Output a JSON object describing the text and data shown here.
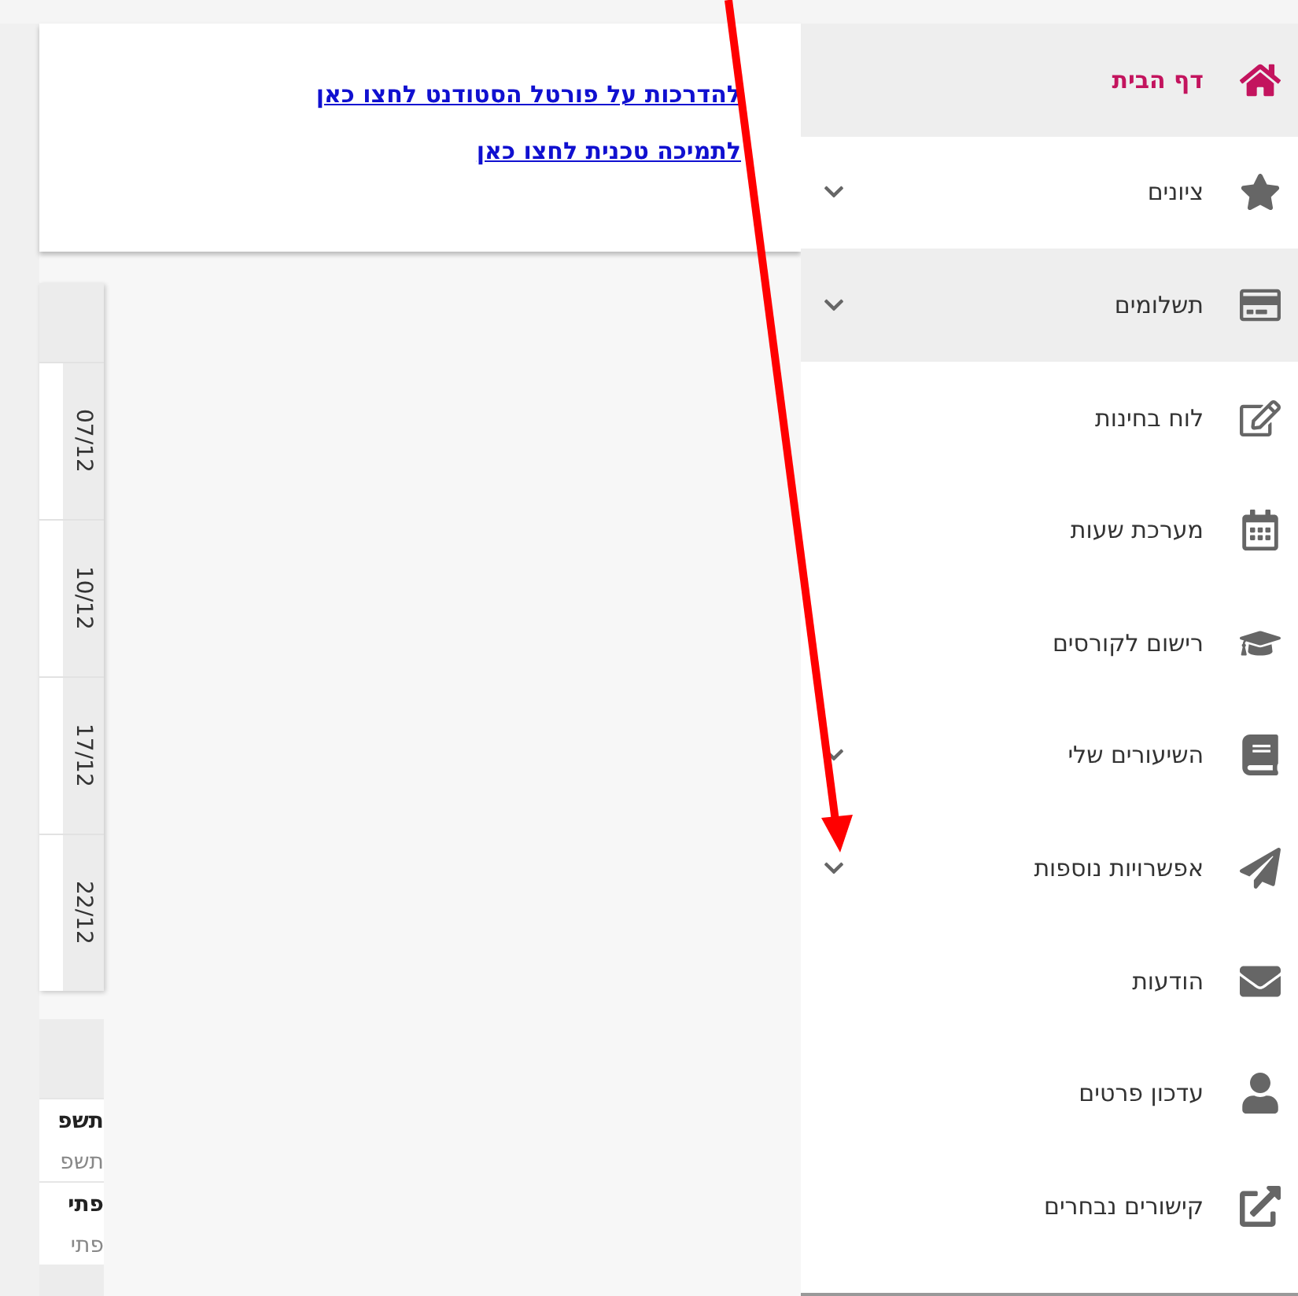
{
  "links": [
    "להדרכות על פורטל הסטודנט לחצו כאן",
    "לתמיכה טכנית לחצו כאן"
  ],
  "dates": [
    "07/12",
    "10/12",
    "17/12",
    "22/12"
  ],
  "lower_panel": {
    "rows": [
      {
        "text": "תשפ",
        "bold": true
      },
      {
        "text": "תשפ",
        "bold": false
      },
      {
        "text": "פתי",
        "bold": true
      },
      {
        "text": "פתי",
        "bold": false
      }
    ]
  },
  "sidebar": {
    "items": [
      {
        "label": "דף הבית",
        "selected": true,
        "highlighted": true,
        "expandable": false
      },
      {
        "label": "ציונים",
        "selected": false,
        "highlighted": false,
        "expandable": true
      },
      {
        "label": "תשלומים",
        "selected": false,
        "highlighted": true,
        "expandable": true
      },
      {
        "label": "לוח בחינות",
        "selected": false,
        "highlighted": false,
        "expandable": false
      },
      {
        "label": "מערכת שעות",
        "selected": false,
        "highlighted": false,
        "expandable": false
      },
      {
        "label": "רישום לקורסים",
        "selected": false,
        "highlighted": false,
        "expandable": false
      },
      {
        "label": "השיעורים שלי",
        "selected": false,
        "highlighted": false,
        "expandable": true
      },
      {
        "label": "אפשרויות נוספות",
        "selected": false,
        "highlighted": false,
        "expandable": true
      },
      {
        "label": "הודעות",
        "selected": false,
        "highlighted": false,
        "expandable": false
      },
      {
        "label": "עדכון פרטים",
        "selected": false,
        "highlighted": false,
        "expandable": false
      },
      {
        "label": "קישורים נבחרים",
        "selected": false,
        "highlighted": false,
        "expandable": false
      }
    ]
  },
  "annotation": {
    "kind": "arrow"
  }
}
